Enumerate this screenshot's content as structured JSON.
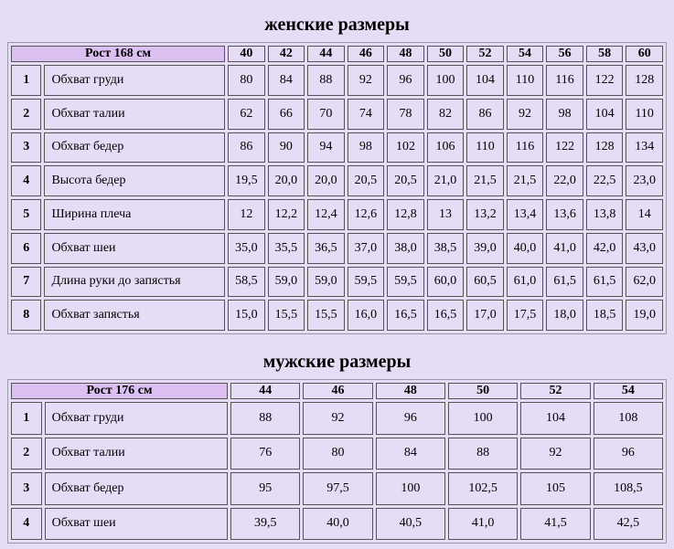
{
  "women": {
    "title": "женские размеры",
    "header": "Рост 168 см",
    "sizes": [
      "40",
      "42",
      "44",
      "46",
      "48",
      "50",
      "52",
      "54",
      "56",
      "58",
      "60"
    ],
    "rows": [
      {
        "num": "1",
        "name": "Обхват груди",
        "values": [
          "80",
          "84",
          "88",
          "92",
          "96",
          "100",
          "104",
          "110",
          "116",
          "122",
          "128"
        ]
      },
      {
        "num": "2",
        "name": "Обхват талии",
        "values": [
          "62",
          "66",
          "70",
          "74",
          "78",
          "82",
          "86",
          "92",
          "98",
          "104",
          "110"
        ]
      },
      {
        "num": "3",
        "name": "Обхват бедер",
        "values": [
          "86",
          "90",
          "94",
          "98",
          "102",
          "106",
          "110",
          "116",
          "122",
          "128",
          "134"
        ]
      },
      {
        "num": "4",
        "name": "Высота бедер",
        "values": [
          "19,5",
          "20,0",
          "20,0",
          "20,5",
          "20,5",
          "21,0",
          "21,5",
          "21,5",
          "22,0",
          "22,5",
          "23,0"
        ]
      },
      {
        "num": "5",
        "name": "Ширина плеча",
        "values": [
          "12",
          "12,2",
          "12,4",
          "12,6",
          "12,8",
          "13",
          "13,2",
          "13,4",
          "13,6",
          "13,8",
          "14"
        ]
      },
      {
        "num": "6",
        "name": "Обхват шеи",
        "values": [
          "35,0",
          "35,5",
          "36,5",
          "37,0",
          "38,0",
          "38,5",
          "39,0",
          "40,0",
          "41,0",
          "42,0",
          "43,0"
        ]
      },
      {
        "num": "7",
        "name": "Длина руки до запястья",
        "values": [
          "58,5",
          "59,0",
          "59,0",
          "59,5",
          "59,5",
          "60,0",
          "60,5",
          "61,0",
          "61,5",
          "61,5",
          "62,0"
        ]
      },
      {
        "num": "8",
        "name": "Обхват запястья",
        "values": [
          "15,0",
          "15,5",
          "15,5",
          "16,0",
          "16,5",
          "16,5",
          "17,0",
          "17,5",
          "18,0",
          "18,5",
          "19,0"
        ]
      }
    ]
  },
  "men": {
    "title": "мужские размеры",
    "header": "Рост 176 см",
    "sizes": [
      "44",
      "46",
      "48",
      "50",
      "52",
      "54"
    ],
    "rows": [
      {
        "num": "1",
        "name": "Обхват груди",
        "values": [
          "88",
          "92",
          "96",
          "100",
          "104",
          "108"
        ]
      },
      {
        "num": "2",
        "name": "Обхват талии",
        "values": [
          "76",
          "80",
          "84",
          "88",
          "92",
          "96"
        ]
      },
      {
        "num": "3",
        "name": "Обхват бедер",
        "values": [
          "95",
          "97,5",
          "100",
          "102,5",
          "105",
          "108,5"
        ]
      },
      {
        "num": "4",
        "name": "Обхват шеи",
        "values": [
          "39,5",
          "40,0",
          "40,5",
          "41,0",
          "41,5",
          "42,5"
        ]
      }
    ]
  },
  "colors": {
    "background": "#e6dcf5",
    "header_cell": "#dcc0f2",
    "cell_border": "#555555"
  }
}
